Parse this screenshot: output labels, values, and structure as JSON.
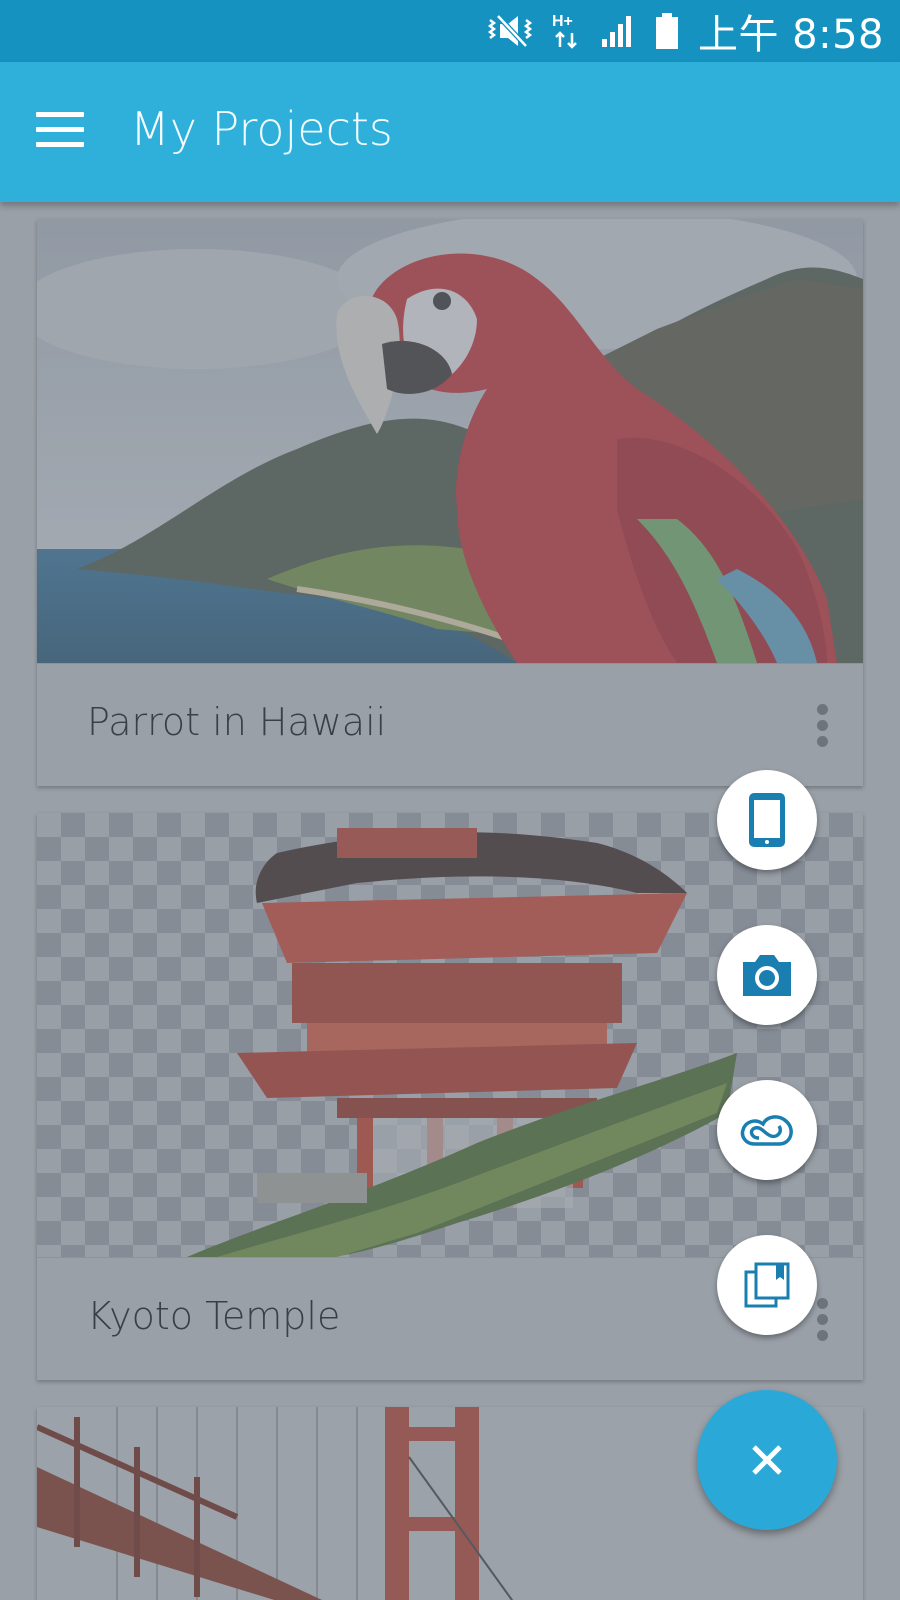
{
  "status_bar": {
    "time": "上午 8:58",
    "icons": [
      "vibrate-mute-icon",
      "hplus-data-icon",
      "signal-icon",
      "battery-icon"
    ],
    "data_label": "H+"
  },
  "app_bar": {
    "title": "My Projects",
    "menu_icon": "hamburger-menu-icon"
  },
  "projects": [
    {
      "title": "Parrot in Hawaii"
    },
    {
      "title": "Kyoto Temple"
    },
    {
      "title": ""
    }
  ],
  "fab_menu": {
    "items": [
      {
        "icon": "device-icon"
      },
      {
        "icon": "camera-icon"
      },
      {
        "icon": "creative-cloud-icon"
      },
      {
        "icon": "library-icon"
      }
    ],
    "main_icon": "close-icon"
  },
  "colors": {
    "status_bar": "#1592bf",
    "app_bar": "#2fb0da",
    "fab": "#2aa9d9",
    "fab_icon": "#1a7fb0"
  }
}
